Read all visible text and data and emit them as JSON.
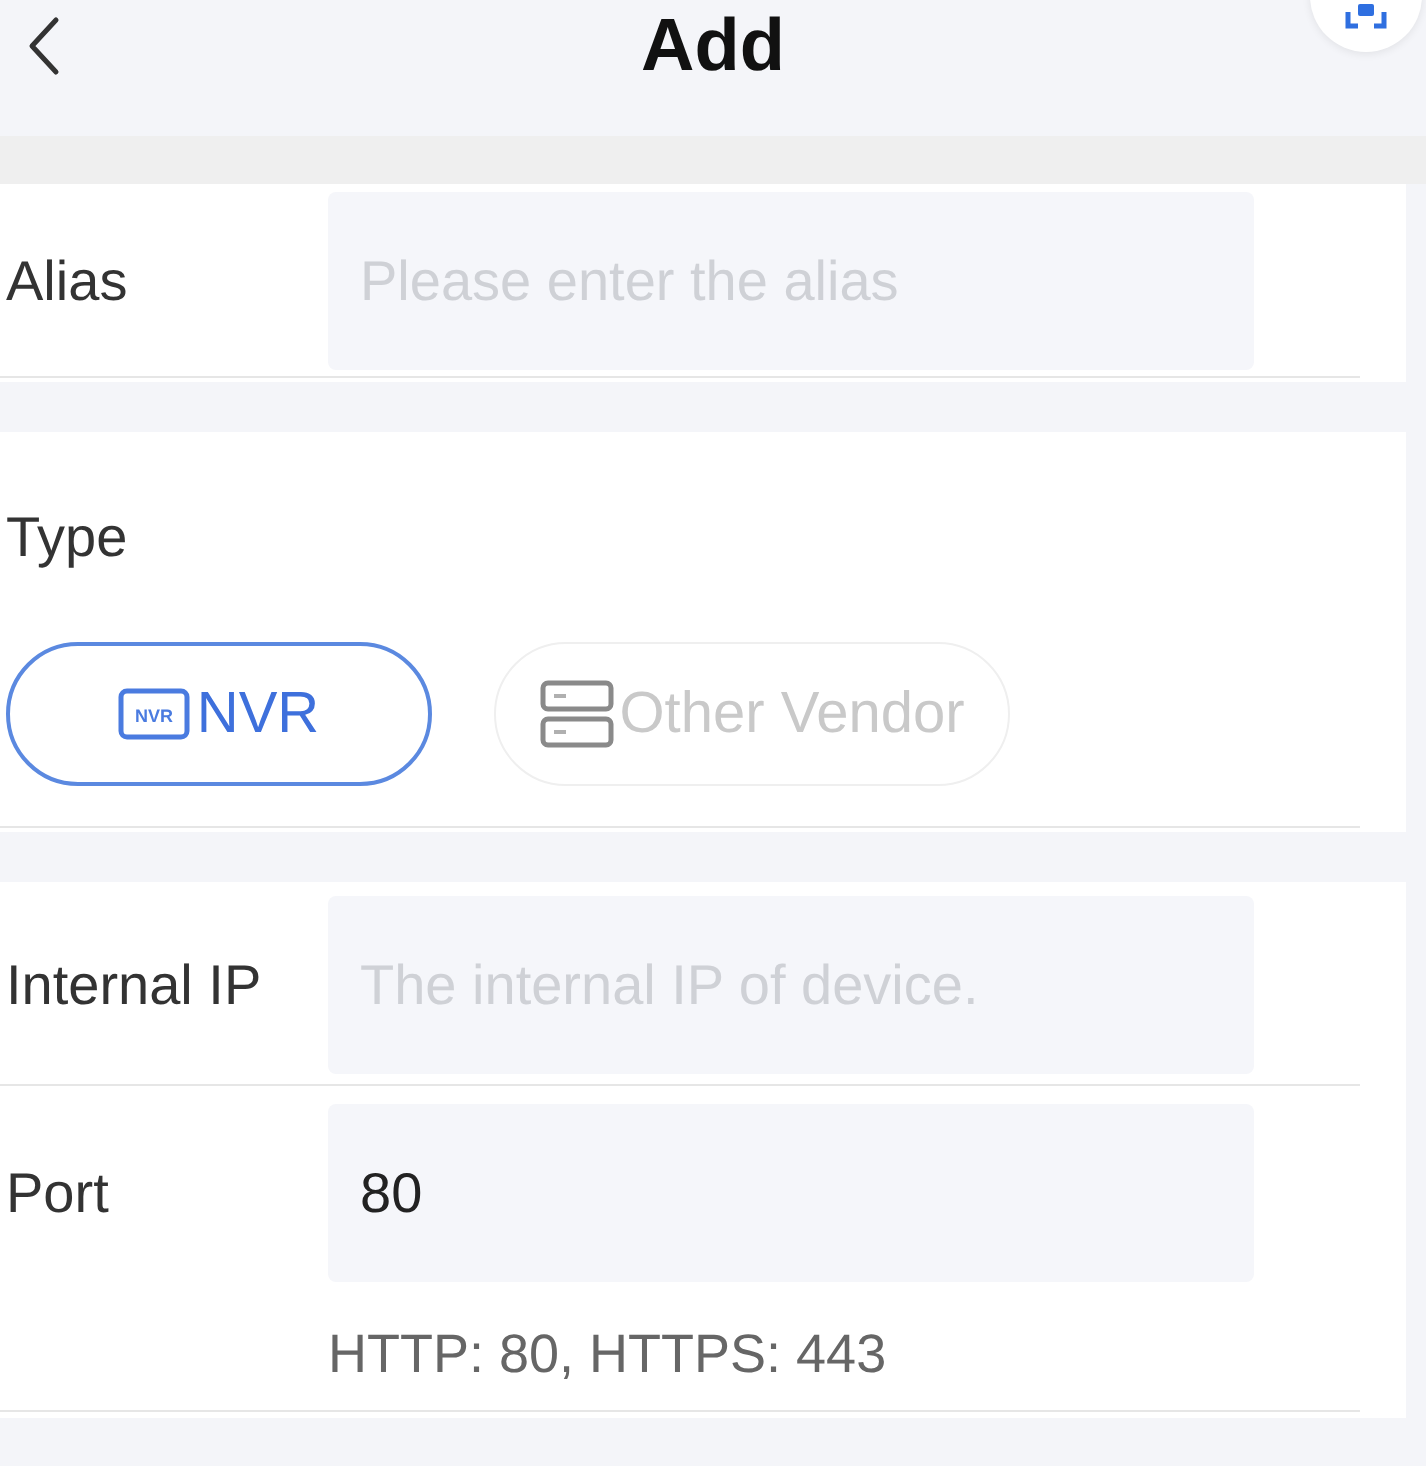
{
  "header": {
    "title": "Add"
  },
  "sections": [
    {
      "kind": "fields",
      "rows": [
        {
          "label": "Alias",
          "placeholder": "Please enter the alias"
        }
      ]
    },
    {
      "kind": "choice",
      "label": "Type",
      "options": [
        {
          "kind": "nvr",
          "icon_text": "NVR",
          "label": "NVR",
          "selected": true
        },
        {
          "kind": "server",
          "label": "Other Vendor",
          "selected": false
        }
      ]
    },
    {
      "kind": "fields",
      "rows": [
        {
          "label": "Internal IP",
          "placeholder": "The internal IP of device."
        },
        {
          "label": "Port",
          "value": "80",
          "hint": "HTTP: 80, HTTPS: 443"
        }
      ]
    }
  ]
}
